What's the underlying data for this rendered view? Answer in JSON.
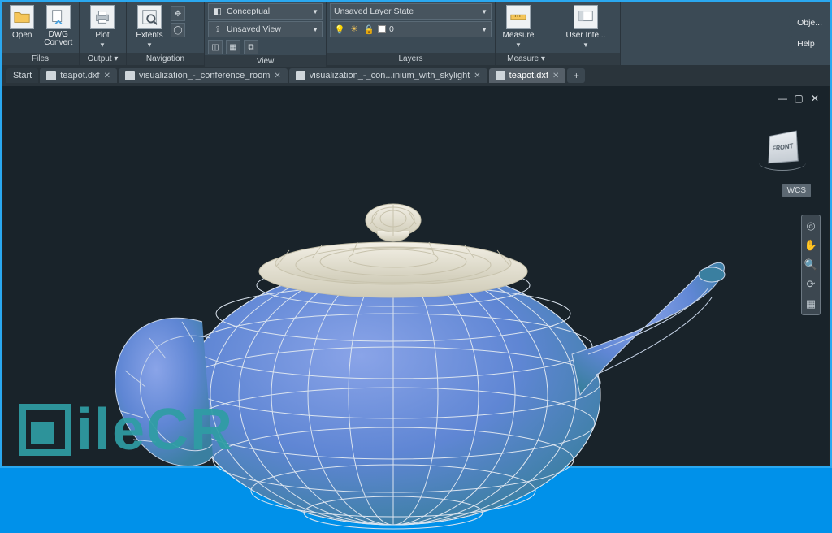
{
  "ribbon": {
    "files": {
      "title": "Files",
      "open": "Open",
      "dwg_convert": "DWG\nConvert"
    },
    "output": {
      "title": "Output ▾",
      "plot": "Plot"
    },
    "navigation": {
      "title": "Navigation",
      "extents": "Extents"
    },
    "view": {
      "title": "View",
      "visual_style": "Conceptual",
      "saved_view": "Unsaved View"
    },
    "layers": {
      "title": "Layers",
      "layer_state": "Unsaved Layer State",
      "current_layer": "0"
    },
    "measure": {
      "title": "Measure ▾",
      "measure": "Measure"
    },
    "obj": {
      "label": "Obje..."
    },
    "ui": {
      "title": "User Inte..."
    },
    "help": {
      "label": "Help"
    }
  },
  "tabs": {
    "start": "Start",
    "items": [
      "teapot.dxf",
      "visualization_-_conference_room",
      "visualization_-_con...inium_with_skylight",
      "teapot.dxf"
    ],
    "active_index": 3
  },
  "viewport": {
    "cube_face": "FRONT",
    "wcs": "WCS"
  },
  "watermark": "ileCR"
}
